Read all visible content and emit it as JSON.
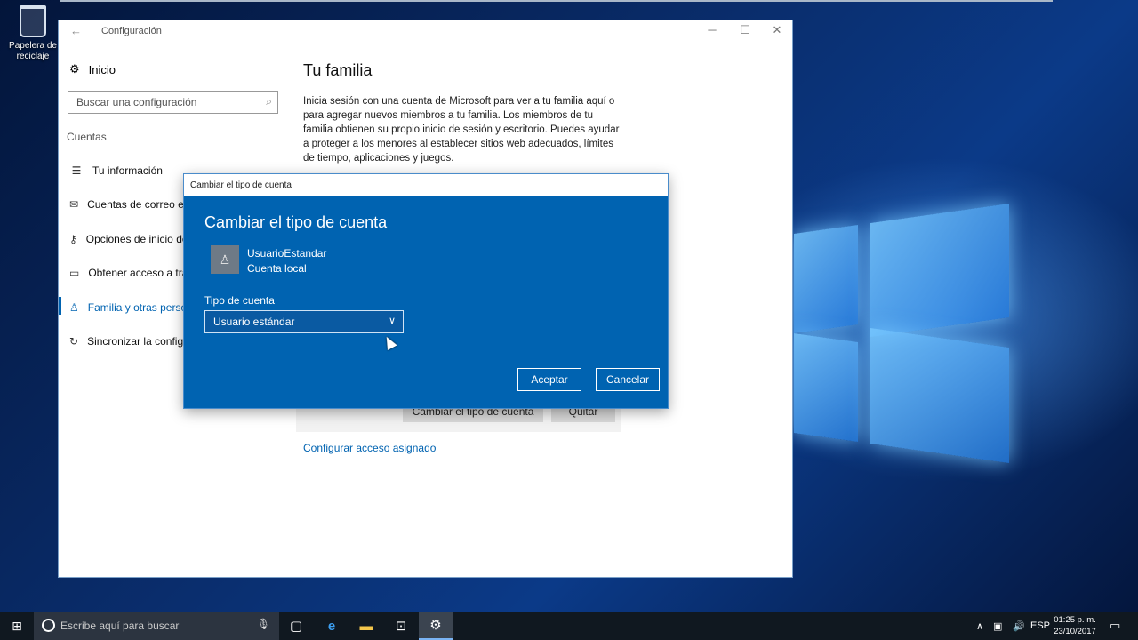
{
  "desktop": {
    "recycle_bin_label": "Papelera de reciclaje"
  },
  "settings": {
    "window_title": "Configuración",
    "nav": {
      "home": "Inicio",
      "search_placeholder": "Buscar una configuración",
      "section": "Cuentas",
      "items": [
        {
          "label": "Tu información",
          "icon": "user-card-icon"
        },
        {
          "label": "Cuentas de correo electrónico y aplicaciones",
          "icon": "mail-icon"
        },
        {
          "label": "Opciones de inicio de sesión",
          "icon": "key-icon"
        },
        {
          "label": "Obtener acceso a trabajo o escuela",
          "icon": "briefcase-icon"
        },
        {
          "label": "Familia y otras personas",
          "icon": "person-icon",
          "active": true
        },
        {
          "label": "Sincronizar la configuración",
          "icon": "sync-icon"
        }
      ]
    },
    "main": {
      "title": "Tu familia",
      "intro": "Inicia sesión con una cuenta de Microsoft para ver a tu familia aquí o para agregar nuevos miembros a tu familia. Los miembros de tu familia obtienen su propio inicio de sesión y escritorio. Puedes ayudar a proteger a los menores al establecer sitios web adecuados, límites de tiempo, aplicaciones y juegos.",
      "change_type_button": "Cambiar el tipo de cuenta",
      "remove_button": "Quitar",
      "assigned_access_link": "Configurar acceso asignado"
    }
  },
  "dialog": {
    "titlebar": "Cambiar el tipo de cuenta",
    "heading": "Cambiar el tipo de cuenta",
    "user_name": "UsuarioEstandar",
    "user_type": "Cuenta local",
    "field_label": "Tipo de cuenta",
    "selected_value": "Usuario estándar",
    "ok_button": "Aceptar",
    "cancel_button": "Cancelar"
  },
  "taskbar": {
    "search_placeholder": "Escribe aquí para buscar",
    "language": "ESP",
    "time": "01:25 p. m.",
    "date": "23/10/2017"
  },
  "colors": {
    "accent": "#0063b1",
    "taskbar": "#101820"
  }
}
